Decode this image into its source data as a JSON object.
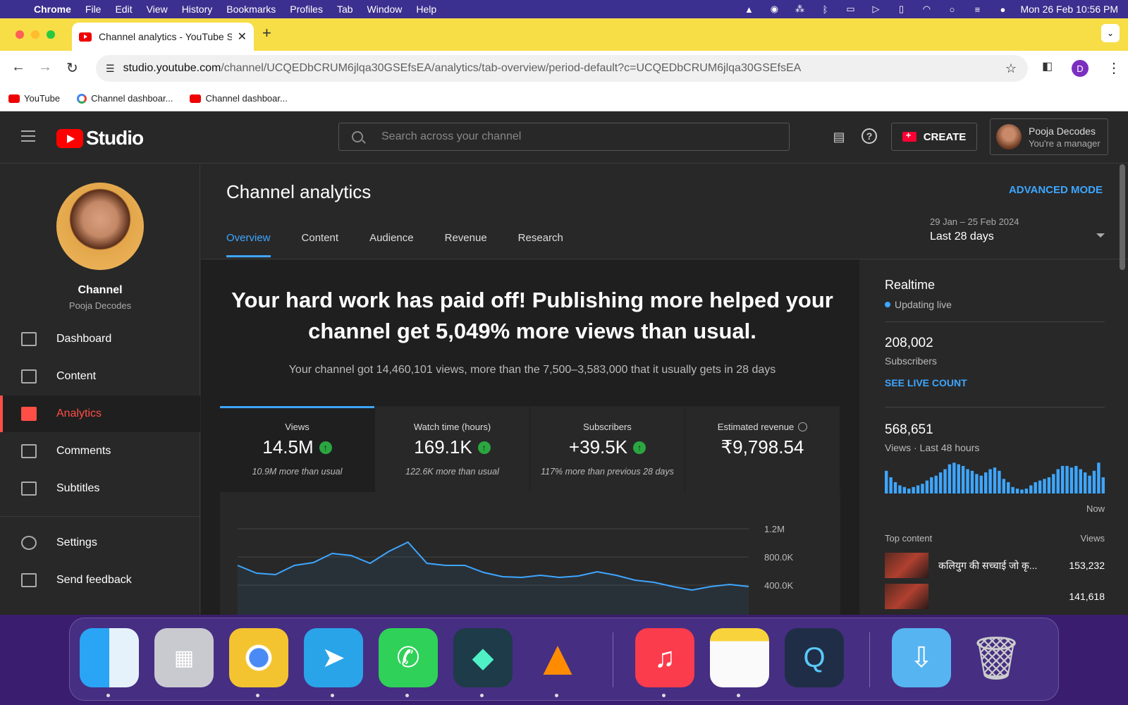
{
  "menubar": {
    "app": "Chrome",
    "items": [
      "File",
      "Edit",
      "View",
      "History",
      "Bookmarks",
      "Profiles",
      "Tab",
      "Window",
      "Help"
    ],
    "datetime": "Mon 26 Feb  10:56 PM"
  },
  "browser": {
    "tab_title": "Channel analytics - YouTube S",
    "url_host": "studio.youtube.com",
    "url_path": "/channel/UCQEDbCRUM6jlqa30GSEfsEA/analytics/tab-overview/period-default?c=UCQEDbCRUM6jlqa30GSEfsEA",
    "profile_initial": "D",
    "bookmarks": [
      "YouTube",
      "Channel dashboar...",
      "Channel dashboar..."
    ]
  },
  "studio": {
    "logo_text": "Studio",
    "search_placeholder": "Search across your channel",
    "create_label": "CREATE",
    "account_name": "Pooja Decodes",
    "account_role": "You're a manager"
  },
  "sidebar": {
    "channel_title": "Channel",
    "channel_name": "Pooja Decodes",
    "items": [
      {
        "label": "Dashboard",
        "icon": "dashboard-icon"
      },
      {
        "label": "Content",
        "icon": "content-icon"
      },
      {
        "label": "Analytics",
        "icon": "analytics-icon",
        "active": true
      },
      {
        "label": "Comments",
        "icon": "comments-icon"
      },
      {
        "label": "Subtitles",
        "icon": "subtitles-icon"
      },
      {
        "label": "Settings",
        "icon": "gear-icon"
      },
      {
        "label": "Send feedback",
        "icon": "feedback-icon"
      }
    ]
  },
  "analytics": {
    "title": "Channel analytics",
    "advanced_mode": "ADVANCED MODE",
    "period_range": "29 Jan – 25 Feb 2024",
    "period_label": "Last 28 days",
    "tabs": [
      "Overview",
      "Content",
      "Audience",
      "Revenue",
      "Research"
    ],
    "headline": "Your hard work has paid off! Publishing more helped your channel get 5,049% more views than usual.",
    "subline": "Your channel got 14,460,101 views, more than the 7,500–3,583,000 that it usually gets in 28 days",
    "cards": [
      {
        "label": "Views",
        "value": "14.5M",
        "note": "10.9M more than usual",
        "trend": "up"
      },
      {
        "label": "Watch time (hours)",
        "value": "169.1K",
        "note": "122.6K more than usual",
        "trend": "up"
      },
      {
        "label": "Subscribers",
        "value": "+39.5K",
        "note": "117% more than previous 28 days",
        "trend": "up"
      },
      {
        "label": "Estimated revenue",
        "value": "₹9,798.54",
        "note": "",
        "trend": "none"
      }
    ]
  },
  "chart_data": {
    "type": "line",
    "yticks": [
      "1.2M",
      "800.0K",
      "400.0K"
    ],
    "ylim": [
      0,
      1200000
    ],
    "values": [
      680000,
      570000,
      550000,
      680000,
      720000,
      850000,
      820000,
      710000,
      880000,
      1010000,
      710000,
      680000,
      680000,
      580000,
      520000,
      510000,
      540000,
      510000,
      530000,
      590000,
      540000,
      470000,
      440000,
      380000,
      330000,
      380000,
      410000,
      380000
    ]
  },
  "realtime": {
    "title": "Realtime",
    "live_label": "Updating live",
    "subscribers_value": "208,002",
    "subscribers_label": "Subscribers",
    "see_live": "SEE LIVE COUNT",
    "views_value": "568,651",
    "views_label": "Views · Last 48 hours",
    "now_label": "Now",
    "bars": [
      0.7,
      0.5,
      0.35,
      0.25,
      0.2,
      0.15,
      0.2,
      0.25,
      0.3,
      0.4,
      0.5,
      0.55,
      0.65,
      0.75,
      0.9,
      0.95,
      0.9,
      0.85,
      0.75,
      0.7,
      0.6,
      0.55,
      0.65,
      0.75,
      0.8,
      0.7,
      0.45,
      0.35,
      0.2,
      0.15,
      0.12,
      0.15,
      0.25,
      0.35,
      0.4,
      0.45,
      0.5,
      0.6,
      0.75,
      0.85,
      0.85,
      0.8,
      0.85,
      0.75,
      0.65,
      0.55,
      0.7,
      0.95,
      0.5
    ],
    "top_content_label": "Top content",
    "views_col": "Views",
    "top_content": [
      {
        "title": "कलियुग की सच्चाई जो कृ...",
        "views": "153,232"
      },
      {
        "title": "",
        "views": "141,618"
      }
    ]
  },
  "colors": {
    "accent": "#3ea6ff",
    "active_red": "#ff4e45",
    "up_green": "#2ba640",
    "chrome_yellow": "#f7dd46"
  },
  "dock": {
    "apps": [
      "finder-icon",
      "launchpad-icon",
      "chrome-icon",
      "telegram-icon",
      "whatsapp-icon",
      "filmora-icon",
      "vlc-icon",
      "music-icon",
      "notes-icon",
      "quicktime-icon",
      "downloads-folder-icon",
      "trash-icon"
    ]
  }
}
